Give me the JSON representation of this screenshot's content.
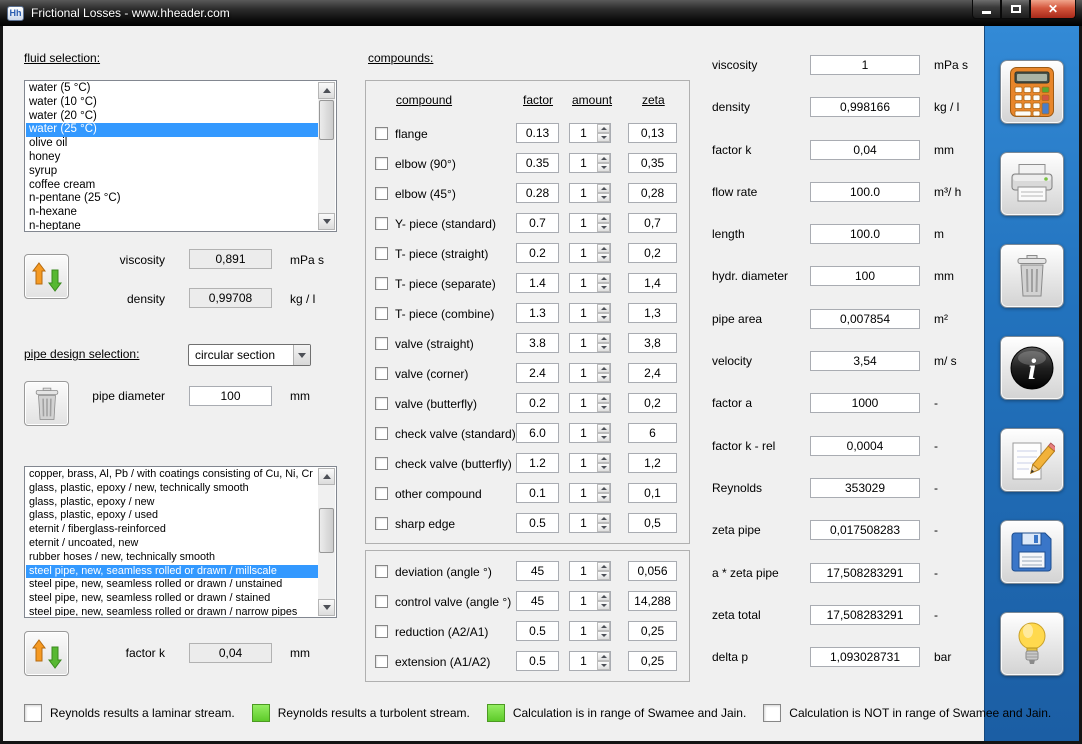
{
  "window": {
    "title": "Frictional Losses - www.hheader.com"
  },
  "fluid": {
    "label": "fluid selection:",
    "items": [
      {
        "label": "water (5 °C)"
      },
      {
        "label": "water (10 °C)"
      },
      {
        "label": "water (20 °C)"
      },
      {
        "label": "water (25 °C)",
        "selected": true
      },
      {
        "label": "olive oil"
      },
      {
        "label": "honey"
      },
      {
        "label": "syrup"
      },
      {
        "label": "coffee cream"
      },
      {
        "label": "n-pentane (25 °C)"
      },
      {
        "label": "n-hexane"
      },
      {
        "label": "n-heptane"
      }
    ],
    "viscosity": {
      "label": "viscosity",
      "value": "0,891",
      "unit": "mPa s"
    },
    "density": {
      "label": "density",
      "value": "0,99708",
      "unit": "kg / l"
    }
  },
  "pipe": {
    "design_label": "pipe design selection:",
    "design_value": "circular section",
    "diameter": {
      "label": "pipe diameter",
      "value": "100",
      "unit": "mm"
    },
    "materials": [
      {
        "label": "copper, brass, Al, Pb / with coatings consisting of Cu, Ni, Cr"
      },
      {
        "label": "glass, plastic, epoxy / new, technically smooth"
      },
      {
        "label": "glass, plastic, epoxy / new"
      },
      {
        "label": "glass, plastic, epoxy / used"
      },
      {
        "label": "eternit / fiberglass-reinforced"
      },
      {
        "label": "eternit / uncoated, new"
      },
      {
        "label": "rubber hoses / new, technically smooth"
      },
      {
        "label": "steel pipe, new, seamless rolled or drawn / millscale",
        "selected": true
      },
      {
        "label": "steel pipe, new, seamless rolled or drawn / unstained"
      },
      {
        "label": "steel pipe, new, seamless rolled or drawn / stained"
      },
      {
        "label": "steel pipe, new, seamless rolled or drawn / narrow pipes"
      }
    ],
    "factor_k": {
      "label": "factor k",
      "value": "0,04",
      "unit": "mm"
    }
  },
  "compounds": {
    "label": "compounds:",
    "headers": {
      "compound": "compound",
      "factor": "factor",
      "amount": "amount",
      "zeta": "zeta"
    },
    "rows": [
      {
        "label": "flange",
        "factor": "0.13",
        "amount": "1",
        "zeta": "0,13"
      },
      {
        "label": "elbow (90°)",
        "factor": "0.35",
        "amount": "1",
        "zeta": "0,35"
      },
      {
        "label": "elbow (45°)",
        "factor": "0.28",
        "amount": "1",
        "zeta": "0,28"
      },
      {
        "label": "Y- piece (standard)",
        "factor": "0.7",
        "amount": "1",
        "zeta": "0,7"
      },
      {
        "label": "T- piece (straight)",
        "factor": "0.2",
        "amount": "1",
        "zeta": "0,2"
      },
      {
        "label": "T- piece (separate)",
        "factor": "1.4",
        "amount": "1",
        "zeta": "1,4"
      },
      {
        "label": "T- piece (combine)",
        "factor": "1.3",
        "amount": "1",
        "zeta": "1,3"
      },
      {
        "label": "valve (straight)",
        "factor": "3.8",
        "amount": "1",
        "zeta": "3,8"
      },
      {
        "label": "valve (corner)",
        "factor": "2.4",
        "amount": "1",
        "zeta": "2,4"
      },
      {
        "label": "valve (butterfly)",
        "factor": "0.2",
        "amount": "1",
        "zeta": "0,2"
      },
      {
        "label": "check valve (standard)",
        "factor": "6.0",
        "amount": "1",
        "zeta": "6"
      },
      {
        "label": "check valve (butterfly)",
        "factor": "1.2",
        "amount": "1",
        "zeta": "1,2"
      },
      {
        "label": "other compound",
        "factor": "0.1",
        "amount": "1",
        "zeta": "0,1"
      },
      {
        "label": "sharp edge",
        "factor": "0.5",
        "amount": "1",
        "zeta": "0,5"
      }
    ],
    "angle_rows": [
      {
        "label": "deviation (angle °)",
        "factor": "45",
        "amount": "1",
        "zeta": "0,056"
      },
      {
        "label": "control valve (angle °)",
        "factor": "45",
        "amount": "1",
        "zeta": "14,288"
      },
      {
        "label": "reduction (A2/A1)",
        "factor": "0.5",
        "amount": "1",
        "zeta": "0,25"
      },
      {
        "label": "extension (A1/A2)",
        "factor": "0.5",
        "amount": "1",
        "zeta": "0,25"
      }
    ]
  },
  "results": {
    "rows": [
      {
        "label": "viscosity",
        "value": "1",
        "unit": "mPa s"
      },
      {
        "label": "density",
        "value": "0,998166",
        "unit": "kg / l"
      },
      {
        "label": "factor  k",
        "value": "0,04",
        "unit": "mm"
      },
      {
        "label": "flow rate",
        "value": "100.0",
        "unit": "m³/ h"
      },
      {
        "label": "length",
        "value": "100.0",
        "unit": "m"
      },
      {
        "label": "hydr. diameter",
        "value": "100",
        "unit": "mm"
      },
      {
        "label": "pipe area",
        "value": "0,007854",
        "unit": "m²"
      },
      {
        "label": "velocity",
        "value": "3,54",
        "unit": "m/ s"
      },
      {
        "label": "factor  a",
        "value": "1000",
        "unit": "-"
      },
      {
        "label": "factor  k - rel",
        "value": "0,0004",
        "unit": "-"
      },
      {
        "label": "Reynolds",
        "value": "353029",
        "unit": "-"
      },
      {
        "label": "zeta pipe",
        "value": "0,017508283",
        "unit": "-"
      },
      {
        "label": "a * zeta pipe",
        "value": "17,508283291",
        "unit": "-"
      },
      {
        "label": "zeta total",
        "value": "17,508283291",
        "unit": "-"
      },
      {
        "label": "delta p",
        "value": "1,093028731",
        "unit": "bar"
      }
    ]
  },
  "sidebar": {
    "buttons": [
      {
        "name": "calculator-icon"
      },
      {
        "name": "printer-icon"
      },
      {
        "name": "trash-icon"
      },
      {
        "name": "info-icon"
      },
      {
        "name": "edit-icon"
      },
      {
        "name": "save-icon"
      },
      {
        "name": "lightbulb-icon"
      }
    ]
  },
  "statusbar": {
    "items": [
      {
        "label": "Reynolds results a laminar stream.",
        "checked": false
      },
      {
        "label": "Reynolds results a turbolent stream.",
        "checked": true
      },
      {
        "label": "Calculation is in range of Swamee and Jain.",
        "checked": true
      },
      {
        "label": "Calculation is NOT in range of Swamee and Jain.",
        "checked": false
      }
    ]
  }
}
